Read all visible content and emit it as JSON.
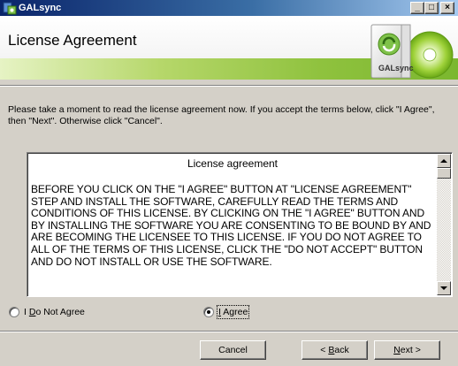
{
  "window": {
    "title": "GALsync",
    "icon": "app-icon"
  },
  "header": {
    "title": "License Agreement",
    "logo_text": "GALsync"
  },
  "instructions": "Please take a moment to read the license agreement now. If you accept the terms below, click \"I Agree\", then \"Next\". Otherwise click \"Cancel\".",
  "license": {
    "heading": "License agreement",
    "body": "BEFORE YOU CLICK ON THE \"I AGREE\" BUTTON AT \"LICENSE AGREEMENT\" STEP AND INSTALL THE SOFTWARE, CAREFULLY READ THE TERMS AND CONDITIONS OF THIS LICENSE. BY CLICKING ON THE \"I AGREE\" BUTTON AND BY INSTALLING THE SOFTWARE YOU ARE CONSENTING TO BE BOUND BY AND ARE BECOMING THE LICENSEE TO THIS LICENSE. IF YOU DO NOT AGREE TO ALL OF THE TERMS OF THIS LICENSE, CLICK THE \"DO NOT ACCEPT\" BUTTON AND DO NOT INSTALL OR USE THE SOFTWARE."
  },
  "options": {
    "disagree": {
      "pre": "I ",
      "accel": "D",
      "post": "o Not Agree",
      "selected": false
    },
    "agree": {
      "pre": "",
      "accel": "I",
      "post": " Agree",
      "selected": true
    }
  },
  "buttons": {
    "cancel": {
      "pre": "Cancel",
      "accel": "",
      "post": ""
    },
    "back": {
      "pre": "< ",
      "accel": "B",
      "post": "ack"
    },
    "next": {
      "pre": "",
      "accel": "N",
      "post": "ext >"
    }
  },
  "colors": {
    "accent_green": "#8fc23e",
    "titlebar_start": "#0a246a",
    "titlebar_end": "#a6caf0",
    "dialog_bg": "#d4d0c8"
  }
}
